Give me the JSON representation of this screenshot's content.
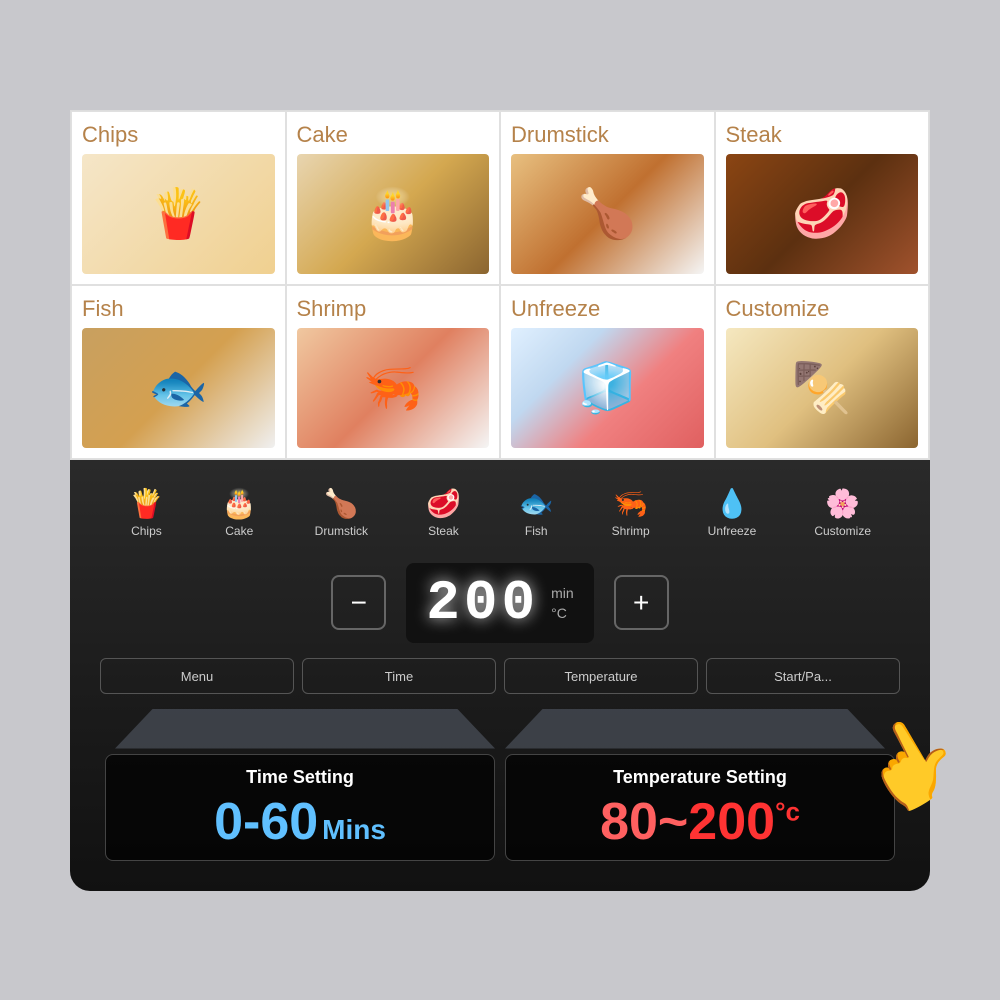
{
  "food_items": [
    {
      "id": "chips",
      "label": "Chips",
      "icon": "🍟",
      "row": 0
    },
    {
      "id": "cake",
      "label": "Cake",
      "icon": "🎂",
      "row": 0
    },
    {
      "id": "drumstick",
      "label": "Drumstick",
      "icon": "🍗",
      "row": 0
    },
    {
      "id": "steak",
      "label": "Steak",
      "icon": "🥩",
      "row": 0
    },
    {
      "id": "fish",
      "label": "Fish",
      "icon": "🐟",
      "row": 1
    },
    {
      "id": "shrimp",
      "label": "Shrimp",
      "icon": "🍤",
      "row": 1
    },
    {
      "id": "unfreeze",
      "label": "Unfreeze",
      "icon": "🧊",
      "row": 1
    },
    {
      "id": "customize",
      "label": "Customize",
      "icon": "🍢",
      "row": 1
    }
  ],
  "menu_icons": [
    {
      "id": "chips",
      "label": "Chips",
      "symbol": "🍟"
    },
    {
      "id": "cake",
      "label": "Cake",
      "symbol": "🎂"
    },
    {
      "id": "drumstick",
      "label": "Drumstick",
      "symbol": "🍗"
    },
    {
      "id": "steak",
      "label": "Steak",
      "symbol": "🥩"
    },
    {
      "id": "fish",
      "label": "Fish",
      "symbol": "🐟"
    },
    {
      "id": "shrimp",
      "label": "Shrimp",
      "symbol": "🦐"
    },
    {
      "id": "unfreeze",
      "label": "Unfreeze",
      "symbol": "💧"
    },
    {
      "id": "customize",
      "label": "Customize",
      "symbol": "🌸"
    }
  ],
  "display": {
    "temperature": "200",
    "unit_min": "min",
    "unit_c": "°C",
    "minus_label": "−",
    "plus_label": "+"
  },
  "controls": {
    "menu_label": "Menu",
    "time_label": "Time",
    "temperature_label": "Temperature",
    "start_label": "Start/Pa..."
  },
  "time_setting": {
    "title": "Time Setting",
    "range_start": "0",
    "range_dash": "-",
    "range_end": "60",
    "range_unit": "Mins"
  },
  "temp_setting": {
    "title": "Temperature Setting",
    "range_start": "80",
    "range_tilde": "~",
    "range_end": "200",
    "range_unit": "°c"
  }
}
